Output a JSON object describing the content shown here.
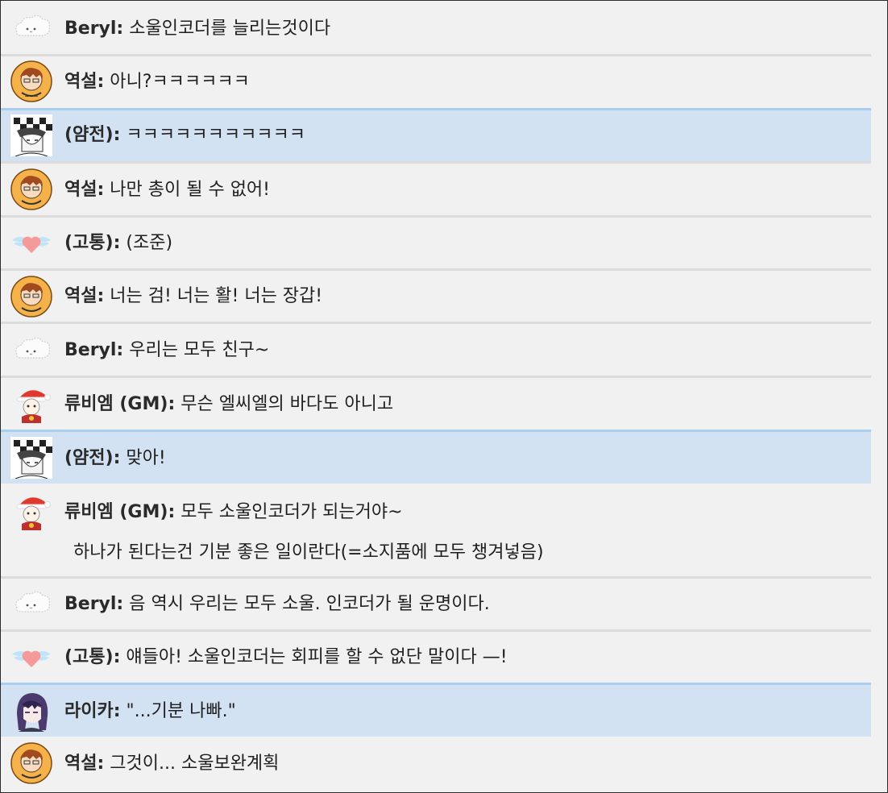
{
  "messages": [
    {
      "speaker": "Beryl:",
      "text": "소울인코더를 늘리는것이다",
      "avatar": "cloud-avatar",
      "hl": false
    },
    {
      "speaker": "역설:",
      "text": "아니?ㅋㅋㅋㅋㅋㅋ",
      "avatar": "orange-badge-avatar",
      "hl": false
    },
    {
      "speaker": "(얌전):",
      "text": "ㅋㅋㅋㅋㅋㅋㅋㅋㅋㅋㅋ",
      "avatar": "sketch-avatar",
      "hl": true
    },
    {
      "speaker": "역설:",
      "text": "나만 총이 될 수 없어!",
      "avatar": "orange-badge-avatar",
      "hl": false
    },
    {
      "speaker": "(고통):",
      "text": "(조준)",
      "avatar": "winged-heart-avatar",
      "hl": false
    },
    {
      "speaker": "역설:",
      "text": "너는 검! 너는 활! 너는 장갑!",
      "avatar": "orange-badge-avatar",
      "hl": false
    },
    {
      "speaker": "Beryl:",
      "text": "우리는 모두 친구~",
      "avatar": "cloud-avatar",
      "hl": false
    },
    {
      "speaker": "류비엠 (GM):",
      "text": "무슨 엘씨엘의 바다도 아니고",
      "avatar": "santa-avatar",
      "hl": false
    },
    {
      "speaker": "(얌전):",
      "text": "맞아!",
      "avatar": "sketch-avatar",
      "hl": true
    },
    {
      "speaker": "류비엠 (GM):",
      "text": "모두 소울인코더가 되는거야~",
      "text2": "하나가 된다는건 기분 좋은 일이란다(=소지품에 모두 챙겨넣음)",
      "avatar": "santa-avatar",
      "hl": false
    },
    {
      "speaker": "Beryl:",
      "text": "음 역시 우리는 모두 소울. 인코더가 될 운명이다.",
      "avatar": "cloud-avatar",
      "hl": false
    },
    {
      "speaker": "(고통):",
      "text": "얘들아! 소울인코더는 회피를 할 수 없단 말이다 —!",
      "avatar": "winged-heart-avatar",
      "hl": false
    },
    {
      "speaker": "라이카:",
      "text": "\"...기분 나빠.\"",
      "avatar": "purple-hair-avatar",
      "hl": true
    },
    {
      "speaker": "역설:",
      "text": "그것이... 소울보완계획",
      "avatar": "orange-badge-avatar",
      "hl": false
    }
  ]
}
